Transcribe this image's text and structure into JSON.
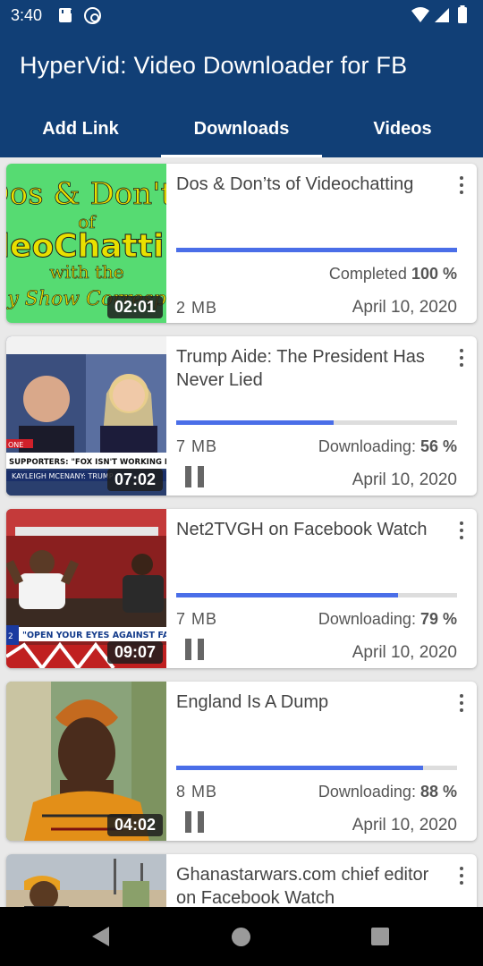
{
  "status_bar": {
    "time": "3:40"
  },
  "app": {
    "title": "HyperVid: Video Downloader for FB"
  },
  "tabs": [
    {
      "label": "Add Link"
    },
    {
      "label": "Downloads"
    },
    {
      "label": "Videos"
    }
  ],
  "downloads": [
    {
      "title": "Dos & Don’ts of Videochatting",
      "duration": "02:01",
      "size": "2  MB",
      "status_label": "Completed",
      "percent": "100 %",
      "progress": 1.0,
      "date": "April 10, 2020"
    },
    {
      "title": "Trump Aide: The President Has Never Lied",
      "duration": "07:02",
      "size": "7  MB",
      "status_label": "Downloading:",
      "percent": "56 %",
      "progress": 0.56,
      "date": "April 10, 2020"
    },
    {
      "title": "Net2TVGH on Facebook Watch",
      "duration": "09:07",
      "size": "7  MB",
      "status_label": "Downloading:",
      "percent": "79 %",
      "progress": 0.79,
      "date": "April 10, 2020"
    },
    {
      "title": "England Is A Dump",
      "duration": "04:02",
      "size": "8  MB",
      "status_label": "Downloading:",
      "percent": "88 %",
      "progress": 0.88,
      "date": "April 10, 2020"
    },
    {
      "title": "Ghanastarwars.com chief editor on Facebook Watch"
    }
  ],
  "thumbnail_text": {
    "t1_line1": "Dos & Don'ts",
    "t1_line2": "of",
    "t1_line3": "leoChatti",
    "t1_line4": "with the",
    "t1_line5": "y Show Corresp",
    "t2_caption": "SUPPORTERS: \"FOX ISN'T WORKING FOR US ANYMORE\"",
    "t2_name": "KAYLEIGH MCENANY: TRUMP",
    "t2_ticker": "ONE",
    "t3_caption": "\"OPEN YOUR EYES AGAINST FAKE PA",
    "t3_num": "2"
  },
  "colors": {
    "primary": "#113f76",
    "progress": "#4a6ee8"
  }
}
